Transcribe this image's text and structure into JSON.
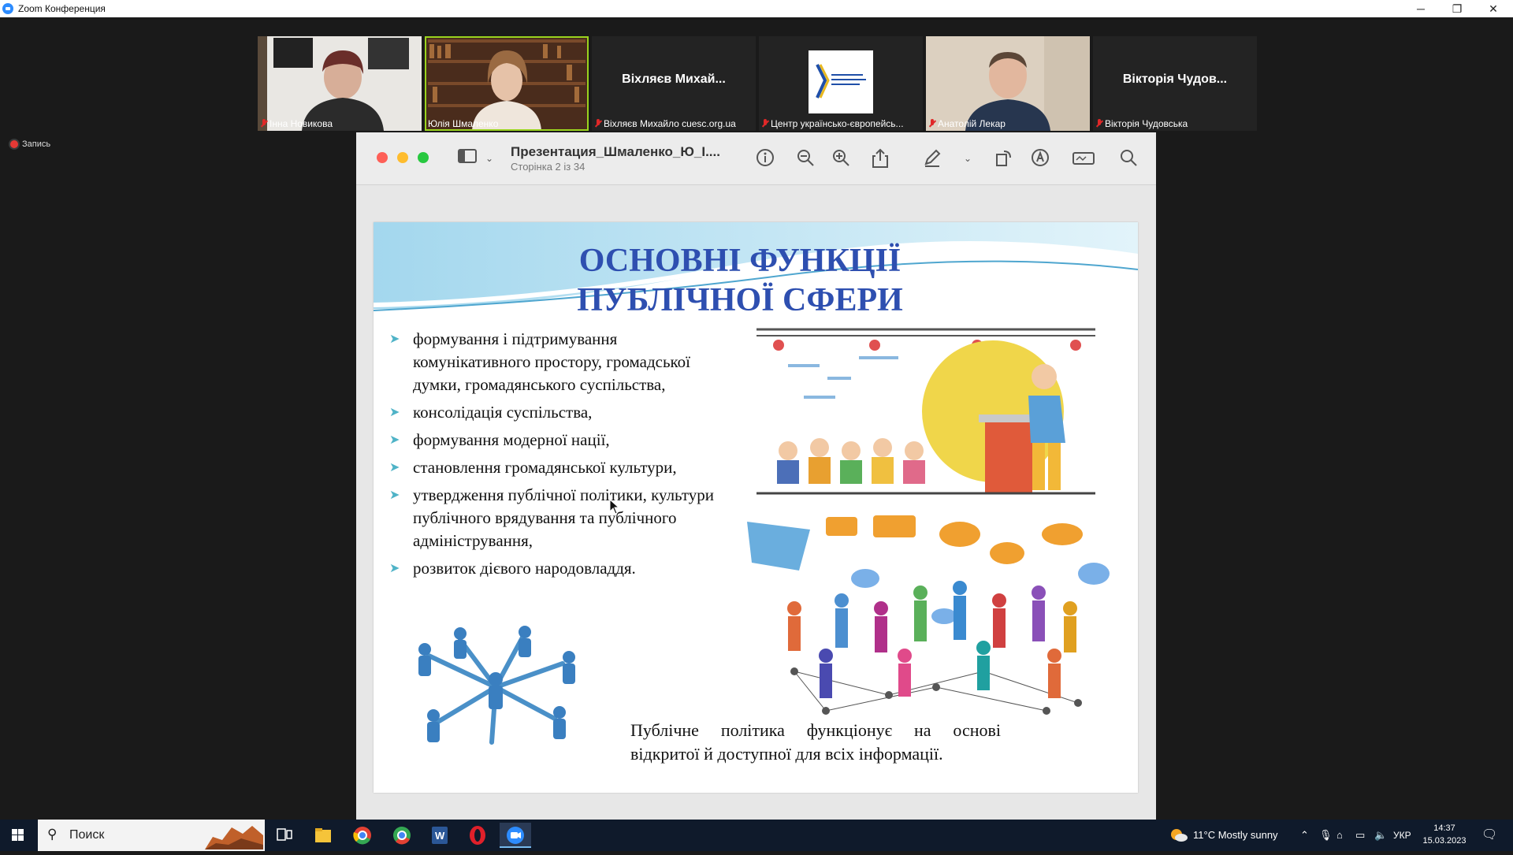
{
  "window": {
    "title": "Zoom Конференция",
    "controls": [
      "─",
      "❐",
      "✕"
    ]
  },
  "gallery": {
    "participants": [
      {
        "name": "Інна Новикова",
        "type": "video",
        "muted": true
      },
      {
        "name": "Юлія Шмаленко",
        "type": "video",
        "muted": false,
        "active": true
      },
      {
        "name": "Віхляєв Михайло cuesc.org.ua",
        "display": "Віхляєв  Михай...",
        "type": "name",
        "muted": true
      },
      {
        "name": "Центр українсько-європейсь...",
        "type": "logo",
        "muted": true
      },
      {
        "name": "Анатолій Лекар",
        "type": "video",
        "muted": true
      },
      {
        "name": "Вікторія Чудовська",
        "display": "Вікторія  Чудов...",
        "type": "name",
        "muted": true
      }
    ],
    "next_button": "›"
  },
  "recording": {
    "label": "Запись"
  },
  "preview": {
    "file_title": "Презентация_Шмаленко_Ю_І....",
    "page_info": "Сторінка 2 із 34",
    "colors": {
      "close": "#fe5f57",
      "minimize": "#febc2e",
      "maximize": "#28c840"
    }
  },
  "slide": {
    "title_line1": "ОСНОВНІ ФУНКЦІЇ",
    "title_line2": "ПУБЛІЧНОЇ СФЕРИ",
    "bullets": [
      "формування і підтримування комунікативного простору, громадської думки, громадянського суспільства,",
      "консолідація суспільства,",
      "формування модерної нації,",
      "становлення громадянської культури,",
      "утвердження публічної політики, культури публічного врядування та публічного адміністрування,",
      "розвиток дієвого народовладдя."
    ],
    "caption": "Публічне політика функціонує на основі відкритої й доступної для всіх інформації."
  },
  "taskbar": {
    "search_placeholder": "Поиск",
    "weather": "11°C  Mostly sunny",
    "language": "УКР",
    "time": "14:37",
    "date": "15.03.2023"
  }
}
